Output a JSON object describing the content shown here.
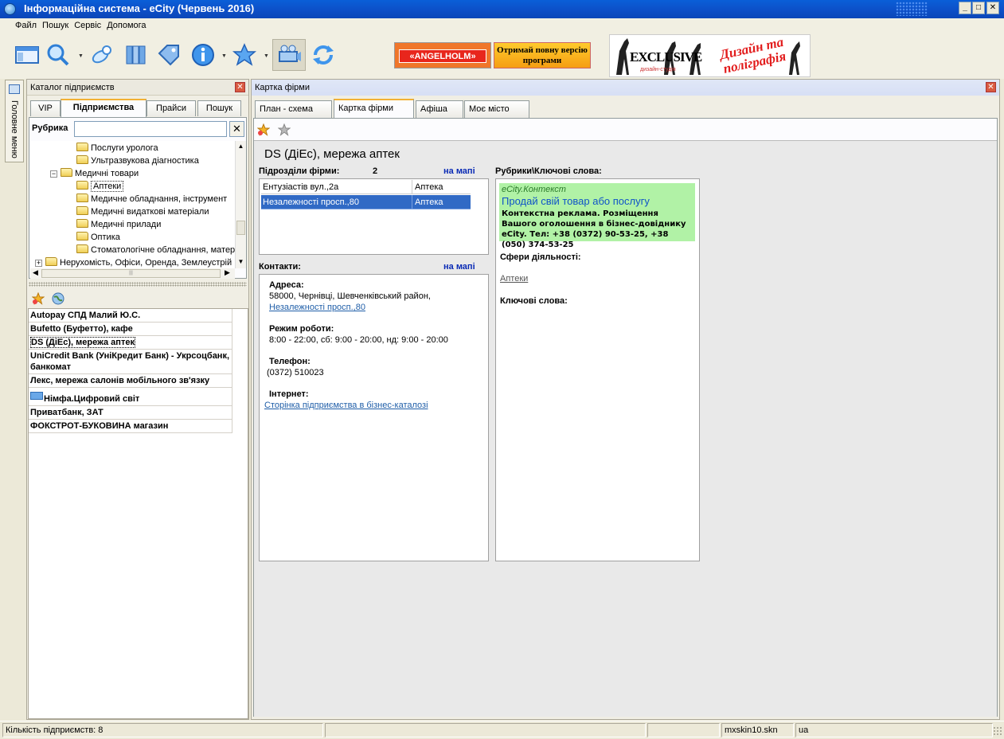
{
  "window": {
    "title": "Інформаційна система - eCity (Червень 2016)",
    "buttons": [
      "_",
      "□",
      "✕"
    ]
  },
  "menu": [
    "Файл",
    "Пошук",
    "Сервіс",
    "Допомога"
  ],
  "toolbar": {
    "icons": [
      "main-view-icon",
      "search-icon",
      "pills-icon",
      "books-icon",
      "tag-icon",
      "info-icon",
      "star-icon",
      "film-projector-icon",
      "refresh-icon"
    ],
    "banner_angelholm": "«ANGELHOLM»",
    "banner_full_version": "Отримай повну версію програми",
    "banner_exclusive": "EXCLUSIVE",
    "banner_studio": "дизайн-студія",
    "banner_design": "Дизайн та поліграфія"
  },
  "side_tab": {
    "label": "Головне меню"
  },
  "catalog": {
    "title": "Каталог підприємств",
    "tabs": [
      "VIP",
      "Підприємства",
      "Прайси",
      "Пошук"
    ],
    "selected_tab": "Підприємства",
    "rubrika_label": "Рубрика",
    "rubrika_value": "",
    "tree": [
      {
        "label": "Послуги уролога",
        "level": 3
      },
      {
        "label": "Ультразвукова діагностика",
        "level": 3
      },
      {
        "label": "Медичні товари",
        "level": 2,
        "expander": "−"
      },
      {
        "label": "Аптеки",
        "level": 3,
        "selected": true
      },
      {
        "label": "Медичне обладнання, інструмент",
        "level": 3
      },
      {
        "label": "Медичні видаткові матеріали",
        "level": 3
      },
      {
        "label": "Медичні прилади",
        "level": 3
      },
      {
        "label": "Оптика",
        "level": 3
      },
      {
        "label": "Стоматологічне обладнання, матер",
        "level": 3
      },
      {
        "label": "Нерухомість, Офіси, Оренда, Землеустрій",
        "level": 1,
        "expander": "+"
      }
    ],
    "firms": [
      {
        "name": "Autopay СПД Малий Ю.С."
      },
      {
        "name": "Bufetto (Буфетто), кафе"
      },
      {
        "name": "DS (ДіЕс), мережа аптек",
        "selected": true
      },
      {
        "name": "UniCredit Bank (УніКредит Банк) - Укрсоцбанк, банкомат"
      },
      {
        "name": "Лекс, мережа салонів мобільного зв'язку"
      },
      {
        "name": "Німфа.Цифровий світ",
        "icon": true
      },
      {
        "name": "Приватбанк, ЗАТ"
      },
      {
        "name": "ФОКСТРОТ-БУКОВИНА магазин"
      }
    ]
  },
  "content": {
    "title": "Картка фірми",
    "tabs": [
      "План - схема",
      "Картка фірми",
      "Афіша",
      "Моє місто"
    ],
    "selected_tab": "Картка фірми",
    "firm_name": "DS (ДіЕс), мережа аптек",
    "subdivisions_label": "Підрозділи фірми:",
    "subdivisions_count": "2",
    "map_link": "на мапі",
    "subdivisions": [
      {
        "address": "Ентузіастів вул.,2а",
        "type": "Аптека"
      },
      {
        "address": "Незалежності просп.,80",
        "type": "Аптека",
        "selected": true
      }
    ],
    "contacts_label": "Контакти:",
    "contacts_map_link": "на мапі",
    "address_label": "Адреса:",
    "address_line": "58000,  Чернівці,  Шевченківський район,",
    "address_link": "Незалежності просп.,80",
    "hours_label": "Режим роботи:",
    "hours_value": "8:00 - 22:00, сб: 9:00 - 20:00, нд: 9:00 - 20:00",
    "phone_label": "Телефон:",
    "phone_value": "(0372) 510023",
    "internet_label": "Інтернет:",
    "internet_link": "Сторінка підприємства в бізнес-каталозі",
    "rubrics_label": "Рубрики\\Ключові слова:",
    "adv": {
      "brand": "eCity.Контекст",
      "headline": "Продай свій товар або послугу",
      "text": "Контекстна реклама. Розміщення Вашого оголошення в бізнес-довіднику eCity. Тел: +38 (0372) 90-53-25, +38 (050) 374-53-25"
    },
    "spheres_label": "Сфери діяльності:",
    "spheres_link": "Аптеки",
    "keywords_label": "Ключові слова:"
  },
  "status": {
    "count": "Кількість підприємств: 8",
    "skin": "mxskin10.skn",
    "lang": "ua"
  }
}
